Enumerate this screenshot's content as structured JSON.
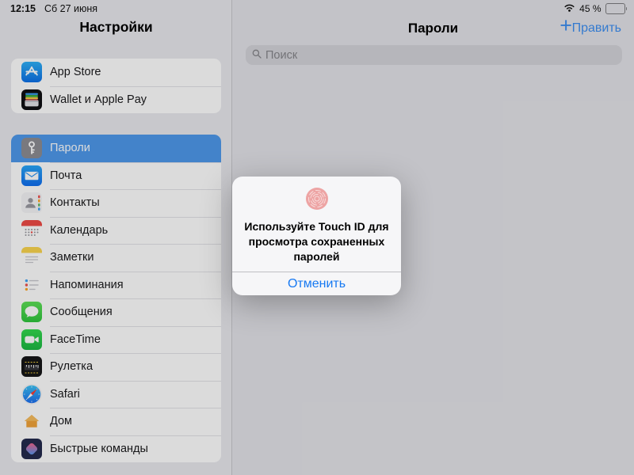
{
  "status_bar": {
    "time": "12:15",
    "date": "Сб 27 июня",
    "battery_percent": "45 %",
    "battery_level": 45
  },
  "sidebar": {
    "title": "Настройки",
    "group1": [
      {
        "label": "App Store",
        "icon": "appstore-icon"
      },
      {
        "label": "Wallet и Apple Pay",
        "icon": "wallet-icon"
      }
    ],
    "group2": [
      {
        "label": "Пароли",
        "icon": "key-icon",
        "selected": true
      },
      {
        "label": "Почта",
        "icon": "mail-icon"
      },
      {
        "label": "Контакты",
        "icon": "contacts-icon"
      },
      {
        "label": "Календарь",
        "icon": "calendar-icon"
      },
      {
        "label": "Заметки",
        "icon": "notes-icon"
      },
      {
        "label": "Напоминания",
        "icon": "reminders-icon"
      },
      {
        "label": "Сообщения",
        "icon": "messages-icon"
      },
      {
        "label": "FaceTime",
        "icon": "facetime-icon"
      },
      {
        "label": "Рулетка",
        "icon": "measure-icon"
      },
      {
        "label": "Safari",
        "icon": "safari-icon"
      },
      {
        "label": "Дом",
        "icon": "home-icon"
      },
      {
        "label": "Быстрые команды",
        "icon": "shortcuts-icon"
      }
    ]
  },
  "main": {
    "title": "Пароли",
    "add_label": "+",
    "edit_label": "Править",
    "search_placeholder": "Поиск"
  },
  "dialog": {
    "message": "Используйте Touch ID для просмотра сохраненных паролей",
    "cancel_label": "Отменить",
    "touchid_icon": "touchid-fingerprint-icon"
  },
  "colors": {
    "accent_blue": "#3d8ff2",
    "selected_row_blue": "#4f99ec",
    "cancel_blue": "#1779f2",
    "touchid_pink": "#eda4a4",
    "dim_overlay": "rgba(0,0,0,0.14)"
  }
}
